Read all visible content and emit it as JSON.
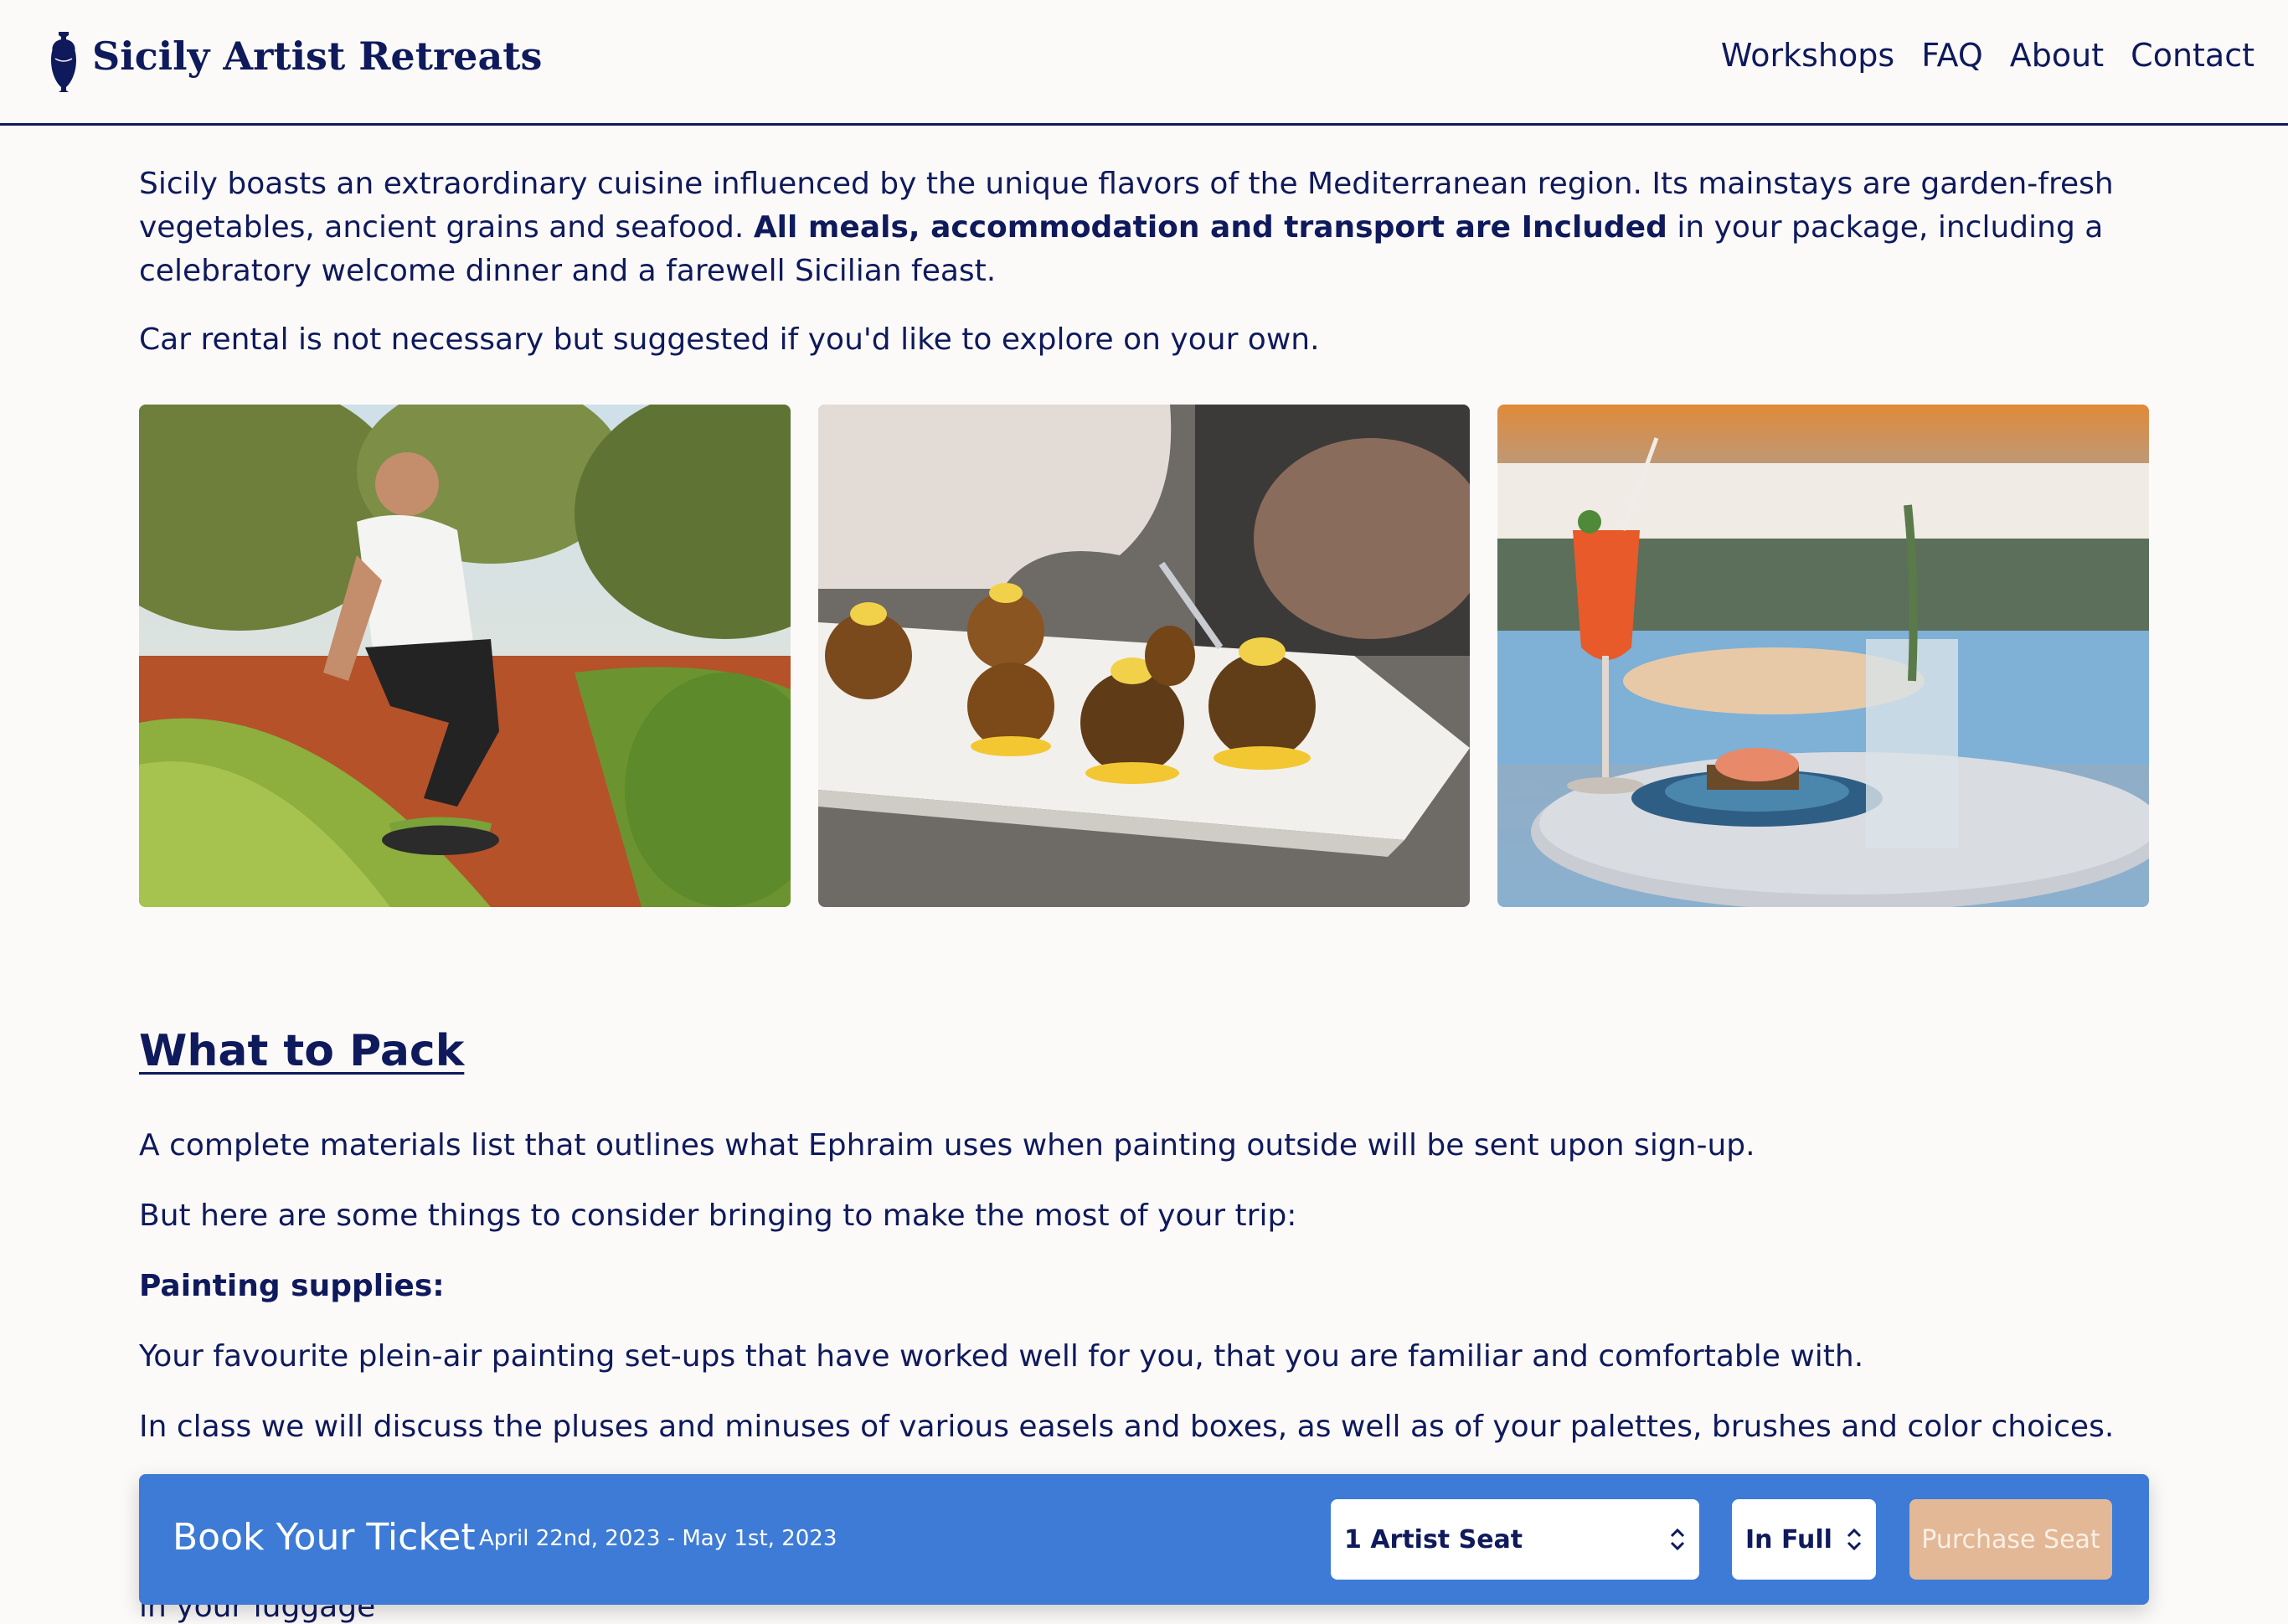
{
  "header": {
    "brand": "Sicily Artist Retreats",
    "nav": [
      "Workshops",
      "FAQ",
      "About",
      "Contact"
    ]
  },
  "content": {
    "cuisine_pre": "Sicily boasts an extraordinary cuisine influenced by the unique flavors of the Mediterranean region. Its mainstays are garden-fresh vegetables, ancient grains and seafood. ",
    "cuisine_bold": "All meals, accommodation and transport are Included",
    "cuisine_post": " in your package, including a celebratory welcome dinner and a farewell Sicilian feast.",
    "car_rental": "Car rental is not necessary but suggested if you'd like to explore on your own.",
    "photos": [
      {
        "icon": "chef-garden-photo"
      },
      {
        "icon": "plated-food-photo"
      },
      {
        "icon": "cocktail-poolside-photo"
      }
    ],
    "pack_title": "What to Pack",
    "pack_p1": "A complete materials list that outlines what Ephraim uses when painting outside will be sent upon sign-up.",
    "pack_p2": "But here are some things to consider bringing to make the most of your trip:",
    "supplies_heading": "Painting supplies:",
    "supplies_p1": "Your favourite plein-air painting set-ups that have worked well for you, that you are familiar and comfortable with.",
    "supplies_p2": "In class we will discuss the pluses and minuses of various easels and boxes, as well as of your palettes, brushes and color choices.",
    "below_bar": "in your luggage"
  },
  "booking": {
    "title": "Book Your Ticket",
    "dates": "April 22nd, 2023 - May 1st, 2023",
    "seat_select": "1 Artist Seat",
    "payment_select": "In Full",
    "purchase_label": "Purchase Seat",
    "bar_color": "#3d7bd6",
    "purchase_color": "#e2b897"
  },
  "colors": {
    "text": "#0f1a5c",
    "background": "#fcfaf8"
  }
}
